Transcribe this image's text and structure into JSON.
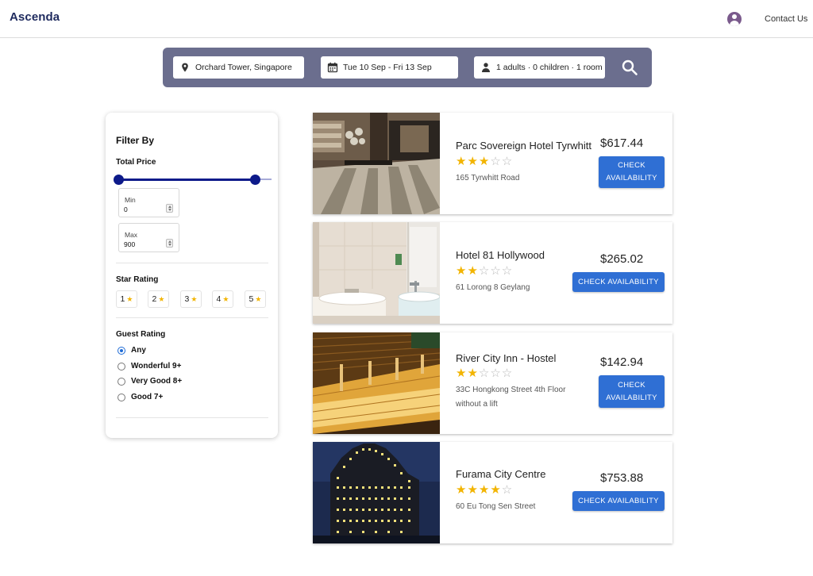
{
  "header": {
    "logo": "Ascenda",
    "contact_label": "Contact Us",
    "avatar_icon": "user-circle-icon"
  },
  "search": {
    "location": "Orchard Tower, Singapore",
    "dates": "Tue 10 Sep - Fri 13 Sep",
    "guests": "1 adults · 0 children · 1 room",
    "location_icon": "map-pin-icon",
    "date_icon": "calendar-icon",
    "guest_icon": "person-icon",
    "search_icon": "magnifier-icon",
    "bar_color": "#6b6e8e"
  },
  "filter": {
    "title": "Filter By",
    "total_price_label": "Total Price",
    "min_label": "Min",
    "min_value": "0",
    "max_label": "Max",
    "max_value": "900",
    "star_rating_label": "Star Rating",
    "star_options": [
      "1",
      "2",
      "3",
      "4",
      "5"
    ],
    "guest_rating_label": "Guest Rating",
    "guest_options": [
      "Any",
      "Wonderful 9+",
      "Very Good 8+",
      "Good 7+"
    ],
    "selected_guest_option": "Any",
    "accent_color": "#0d1a8a"
  },
  "hotels": [
    {
      "name": "Parc Sovereign Hotel Tyrwhitt",
      "stars": 3,
      "address": "165 Tyrwhitt Road",
      "price": "$617.44",
      "button": "Check Availability"
    },
    {
      "name": "Hotel 81 Hollywood",
      "stars": 2,
      "address": "61 Lorong 8 Geylang",
      "price": "$265.02",
      "button": "Check Availability"
    },
    {
      "name": "River City Inn - Hostel",
      "stars": 2,
      "address": "33C Hongkong Street 4th Floor without a lift",
      "price": "$142.94",
      "button": "Check Availability"
    },
    {
      "name": "Furama City Centre",
      "stars": 4,
      "address": "60 Eu Tong Sen Street",
      "price": "$753.88",
      "button": "Check Availability"
    }
  ],
  "colors": {
    "button": "#2f6fd4",
    "star": "#f2b400",
    "radio_selected": "#1e6bd6"
  }
}
